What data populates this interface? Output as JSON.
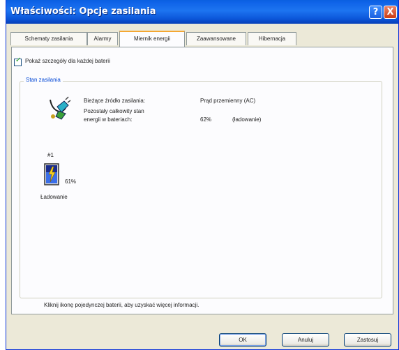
{
  "window": {
    "title": "Właściwości: Opcje zasilania",
    "help_glyph": "?",
    "close_glyph": "X"
  },
  "tabs": [
    {
      "label": "Schematy zasilania",
      "active": false
    },
    {
      "label": "Alarmy",
      "active": false
    },
    {
      "label": "Miernik energii",
      "active": true
    },
    {
      "label": "Zaawansowane",
      "active": false
    },
    {
      "label": "Hibernacja",
      "active": false
    }
  ],
  "options": {
    "show_details_label": "Pokaż szczegóły dla każdej baterii",
    "show_details_checked": true
  },
  "power_status": {
    "group_title": "Stan zasilania",
    "source_label": "Bieżące źródło zasilania:",
    "source_value": "Prąd przemienny (AC)",
    "remaining_label_line1": "Pozostały całkowity stan",
    "remaining_label_line2": "energii w bateriach:",
    "remaining_percent": "62%",
    "remaining_status": "(ładowanie)"
  },
  "battery": {
    "number": "#1",
    "percent": "61%",
    "status": "Ładowanie",
    "level": 0.61
  },
  "footer_note": "Kliknij ikonę pojedynczej baterii, aby uzyskać więcej informacji.",
  "buttons": {
    "ok": "OK",
    "cancel": "Anuluj",
    "apply": "Zastosuj"
  },
  "colors": {
    "titlebar": "#0b55d8",
    "tab_highlight": "#f4a732",
    "group_title": "#0046d5",
    "dialog_bg": "#ece9d8"
  }
}
